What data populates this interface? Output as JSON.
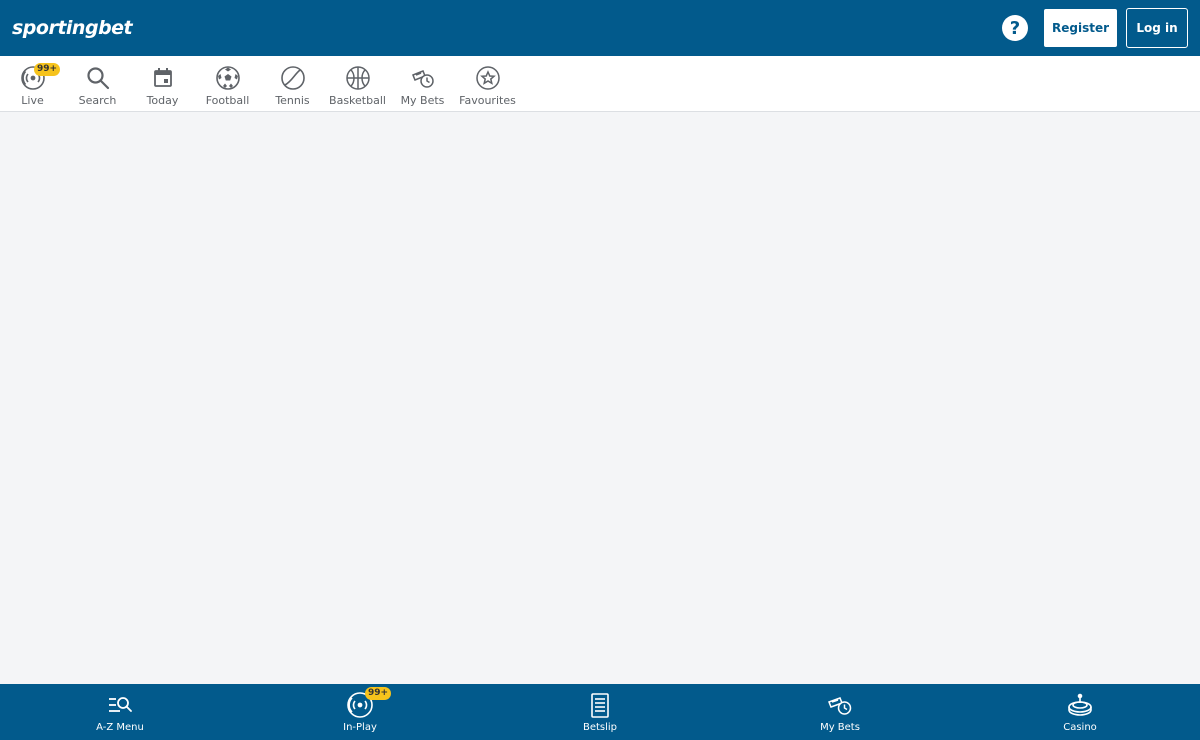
{
  "header": {
    "logo": {
      "part1": "sporting",
      "part2": "bet"
    },
    "help_label": "?",
    "register_label": "Register",
    "login_label": "Log in"
  },
  "topnav": {
    "items": [
      {
        "label": "Live",
        "icon": "live-icon",
        "badge": "99+"
      },
      {
        "label": "Search",
        "icon": "search-icon"
      },
      {
        "label": "Today",
        "icon": "calendar-icon"
      },
      {
        "label": "Football",
        "icon": "football-icon"
      },
      {
        "label": "Tennis",
        "icon": "tennis-ball-icon"
      },
      {
        "label": "Basketball",
        "icon": "basketball-icon"
      },
      {
        "label": "My Bets",
        "icon": "my-bets-icon"
      },
      {
        "label": "Favourites",
        "icon": "star-icon"
      }
    ]
  },
  "bottombar": {
    "items": [
      {
        "label": "A-Z Menu",
        "icon": "az-menu-icon"
      },
      {
        "label": "In-Play",
        "icon": "in-play-icon",
        "badge": "99+"
      },
      {
        "label": "Betslip",
        "icon": "betslip-icon"
      },
      {
        "label": "My Bets",
        "icon": "my-bets-icon"
      },
      {
        "label": "Casino",
        "icon": "casino-icon"
      }
    ]
  },
  "colors": {
    "brand": "#025a8c",
    "badge": "#f6c31c",
    "background": "#f4f5f7",
    "icon_gray": "#5f6368"
  }
}
